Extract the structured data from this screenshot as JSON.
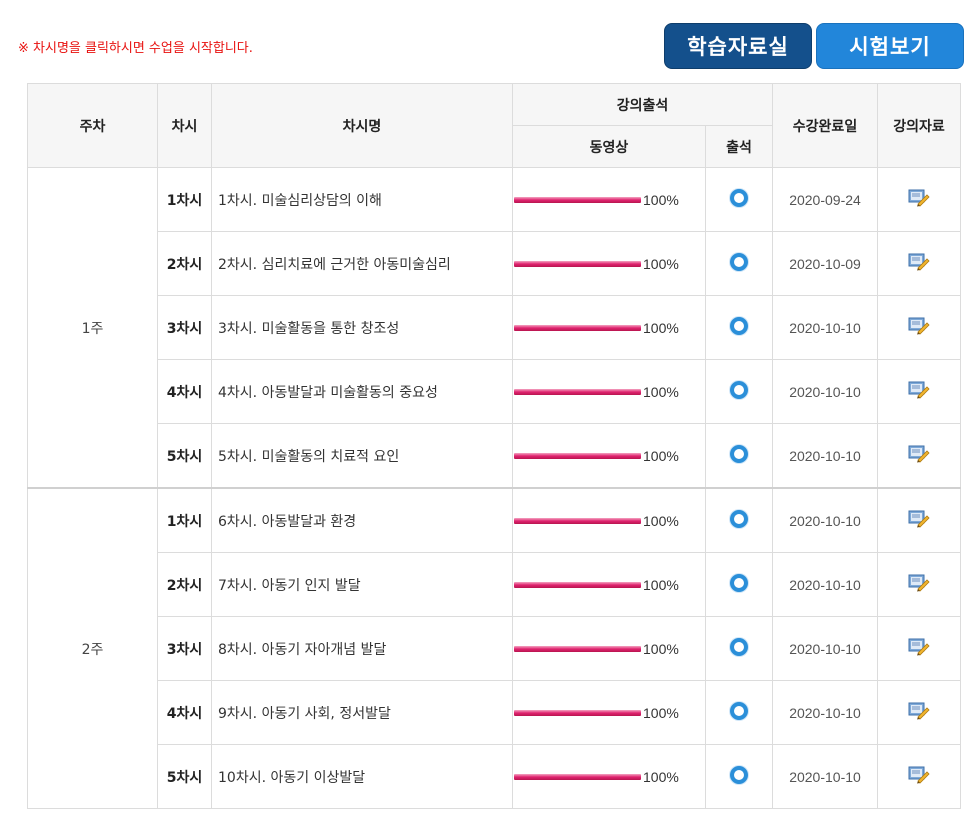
{
  "notice": "※ 차시명을 클릭하시면 수업을 시작합니다.",
  "buttons": {
    "study_room": "학습자료실",
    "exam": "시험보기"
  },
  "colors": {
    "notice": "#e8110f",
    "study_btn": "#14508c",
    "exam_btn": "#2286da",
    "progress": "#e0236f",
    "attendance": "#2b8fd9"
  },
  "table": {
    "headers": {
      "week": "주차",
      "session": "차시",
      "title": "차시명",
      "attendance_group": "강의출석",
      "video": "동영상",
      "attendance": "출석",
      "complete_date": "수강완료일",
      "materials": "강의자료"
    },
    "rows": [
      {
        "week": "1주",
        "session": "1차시",
        "title": "1차시. 미술심리상담의 이해",
        "progress": "100%",
        "attendance_icon": "circle-o-icon",
        "date": "2020-09-24",
        "material_icon": "document-edit-icon"
      },
      {
        "session": "2차시",
        "title": "2차시. 심리치료에 근거한 아동미술심리",
        "progress": "100%",
        "attendance_icon": "circle-o-icon",
        "date": "2020-10-09",
        "material_icon": "document-edit-icon"
      },
      {
        "session": "3차시",
        "title": "3차시. 미술활동을 통한 창조성",
        "progress": "100%",
        "attendance_icon": "circle-o-icon",
        "date": "2020-10-10",
        "material_icon": "document-edit-icon"
      },
      {
        "session": "4차시",
        "title": "4차시. 아동발달과 미술활동의 중요성",
        "progress": "100%",
        "attendance_icon": "circle-o-icon",
        "date": "2020-10-10",
        "material_icon": "document-edit-icon"
      },
      {
        "session": "5차시",
        "title": "5차시. 미술활동의 치료적 요인",
        "progress": "100%",
        "attendance_icon": "circle-o-icon",
        "date": "2020-10-10",
        "material_icon": "document-edit-icon"
      },
      {
        "week": "2주",
        "session": "1차시",
        "title": "6차시. 아동발달과 환경",
        "progress": "100%",
        "attendance_icon": "circle-o-icon",
        "date": "2020-10-10",
        "material_icon": "document-edit-icon"
      },
      {
        "session": "2차시",
        "title": "7차시. 아동기 인지 발달",
        "progress": "100%",
        "attendance_icon": "circle-o-icon",
        "date": "2020-10-10",
        "material_icon": "document-edit-icon"
      },
      {
        "session": "3차시",
        "title": "8차시. 아동기 자아개념 발달",
        "progress": "100%",
        "attendance_icon": "circle-o-icon",
        "date": "2020-10-10",
        "material_icon": "document-edit-icon"
      },
      {
        "session": "4차시",
        "title": "9차시. 아동기 사회, 정서발달",
        "progress": "100%",
        "attendance_icon": "circle-o-icon",
        "date": "2020-10-10",
        "material_icon": "document-edit-icon"
      },
      {
        "session": "5차시",
        "title": "10차시. 아동기 이상발달",
        "progress": "100%",
        "attendance_icon": "circle-o-icon",
        "date": "2020-10-10",
        "material_icon": "document-edit-icon"
      }
    ]
  }
}
